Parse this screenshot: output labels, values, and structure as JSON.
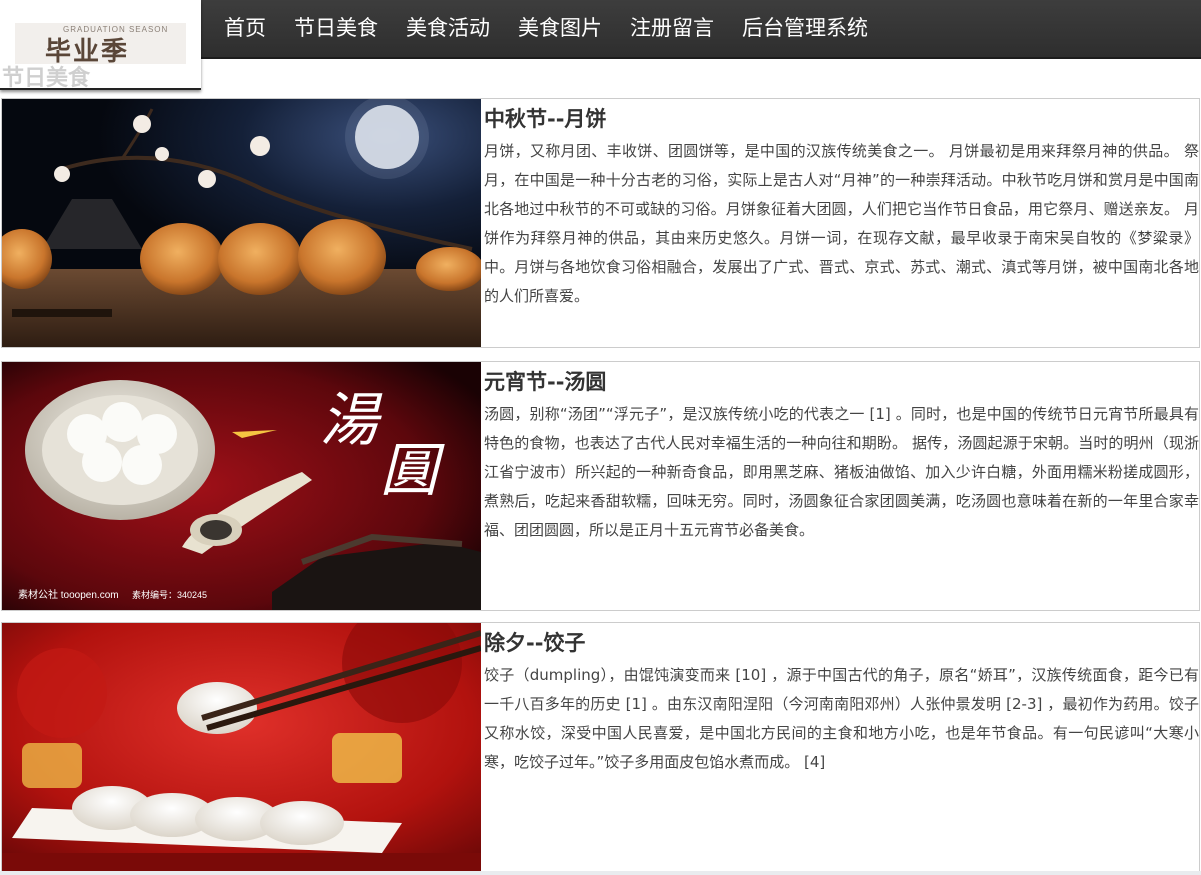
{
  "logo": {
    "small_text": "GRADUATION SEASON",
    "big_text": "毕业季"
  },
  "nav": {
    "items": [
      "首页",
      "节日美食",
      "美食活动",
      "美食图片",
      "注册留言",
      "后台管理系统"
    ]
  },
  "section": {
    "title": "节日美食"
  },
  "cards": [
    {
      "title": "中秋节--月饼",
      "body": "月饼，又称月团、丰收饼、团圆饼等，是中国的汉族传统美食之一。 月饼最初是用来拜祭月神的供品。 祭月，在中国是一种十分古老的习俗，实际上是古人对“月神”的一种崇拜活动。中秋节吃月饼和赏月是中国南北各地过中秋节的不可或缺的习俗。月饼象征着大团圆，人们把它当作节日食品，用它祭月、赠送亲友。 月饼作为拜祭月神的供品，其由来历史悠久。月饼一词，在现存文献，最早收录于南宋吴自牧的《梦粱录》中。月饼与各地饮食习俗相融合，发展出了广式、晋式、京式、苏式、潮式、滇式等月饼，被中国南北各地的人们所喜爱。"
    },
    {
      "title": "元宵节--汤圆",
      "body": "汤圆，别称“汤团”“浮元子”，是汉族传统小吃的代表之一 [1] 。同时，也是中国的传统节日元宵节所最具有特色的食物，也表达了古代人民对幸福生活的一种向往和期盼。 据传，汤圆起源于宋朝。当时的明州（现浙江省宁波市）所兴起的一种新奇食品，即用黑芝麻、猪板油做馅、加入少许白糖，外面用糯米粉搓成圆形，煮熟后，吃起来香甜软糯，回味无穷。同时，汤圆象征合家团圆美满，吃汤圆也意味着在新的一年里合家幸福、团团圆圆，所以是正月十五元宵节必备美食。",
      "image_caption": "汤圆",
      "image_watermark": "素材公社 tooopen.com",
      "image_code": "素材编号：340245"
    },
    {
      "title": "除夕--饺子",
      "body": "饺子（dumpling），由馄饨演变而来 [10] ，源于中国古代的角子，原名“娇耳”，汉族传统面食，距今已有一千八百多年的历史 [1] 。由东汉南阳涅阳（今河南南阳邓州）人张仲景发明 [2-3] ，最初作为药用。饺子又称水饺，深受中国人民喜爱，是中国北方民间的主食和地方小吃，也是年节食品。有一句民谚叫“大寒小寒，吃饺子过年。”饺子多用面皮包馅水煮而成。 [4]"
    }
  ],
  "colors": {
    "navbar": "#333333",
    "nav_text": "#ffffff",
    "title_text": "#333333",
    "body_text": "#444444",
    "section_title": "#cfcfcf"
  }
}
